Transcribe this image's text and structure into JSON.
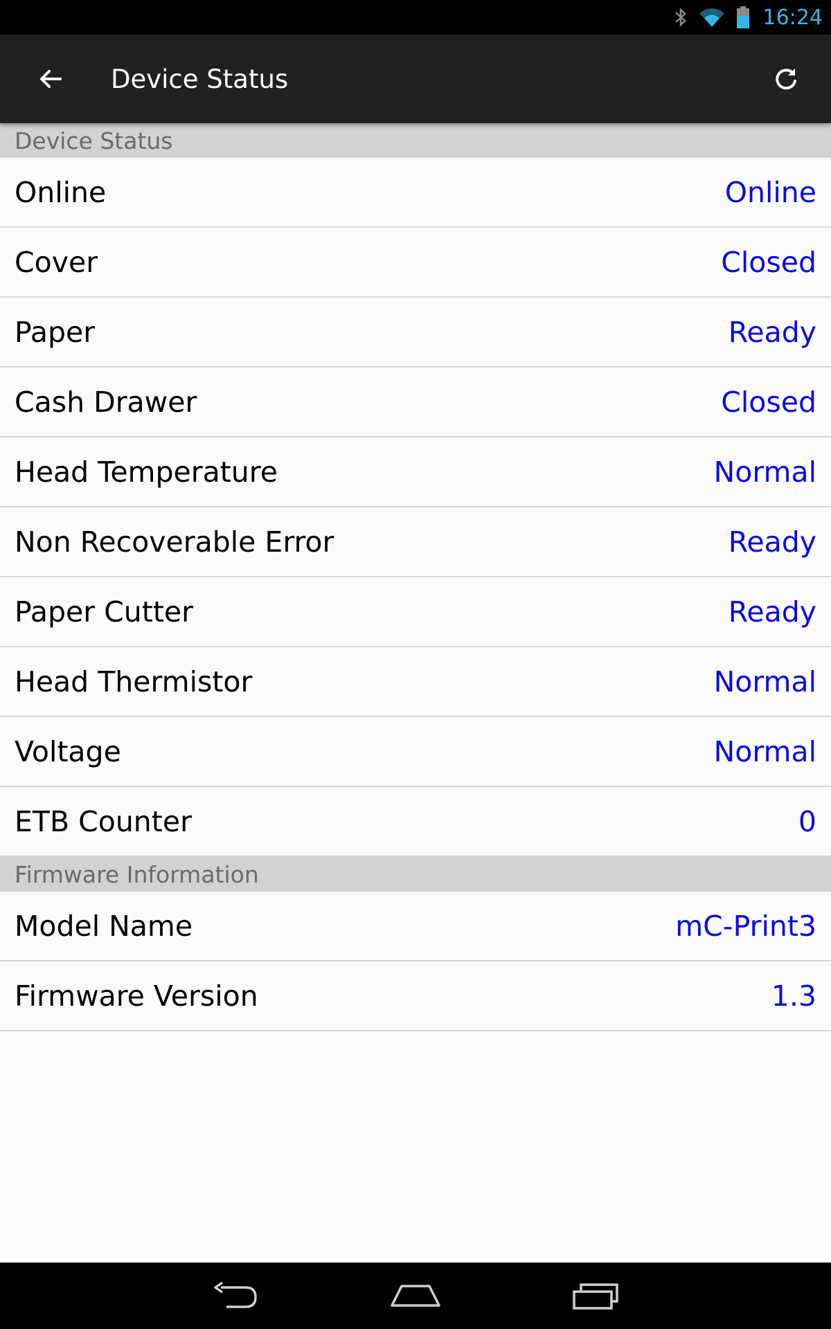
{
  "status_bar": {
    "time": "16:24",
    "icons": [
      "bluetooth-icon",
      "wifi-icon",
      "battery-icon"
    ]
  },
  "app_bar": {
    "title": "Device Status",
    "back_icon": "arrow-left-icon",
    "refresh_icon": "refresh-icon"
  },
  "sections": [
    {
      "header": "Device Status",
      "rows": [
        {
          "label": "Online",
          "value": "Online"
        },
        {
          "label": "Cover",
          "value": "Closed"
        },
        {
          "label": "Paper",
          "value": "Ready"
        },
        {
          "label": "Cash Drawer",
          "value": "Closed"
        },
        {
          "label": "Head Temperature",
          "value": "Normal"
        },
        {
          "label": "Non Recoverable Error",
          "value": "Ready"
        },
        {
          "label": "Paper Cutter",
          "value": "Ready"
        },
        {
          "label": "Head Thermistor",
          "value": "Normal"
        },
        {
          "label": "Voltage",
          "value": "Normal"
        },
        {
          "label": "ETB Counter",
          "value": "0"
        }
      ]
    },
    {
      "header": "Firmware Information",
      "rows": [
        {
          "label": "Model Name",
          "value": "mC-Print3"
        },
        {
          "label": "Firmware Version",
          "value": "1.3"
        }
      ]
    }
  ],
  "nav_bar": {
    "icons": [
      "back-nav-icon",
      "home-nav-icon",
      "recents-nav-icon"
    ]
  },
  "colors": {
    "app_bar": "#212121",
    "value_text": "#0a0ae6",
    "section_header_bg": "#d2d2d2",
    "status_accent": "#33b5e5"
  }
}
